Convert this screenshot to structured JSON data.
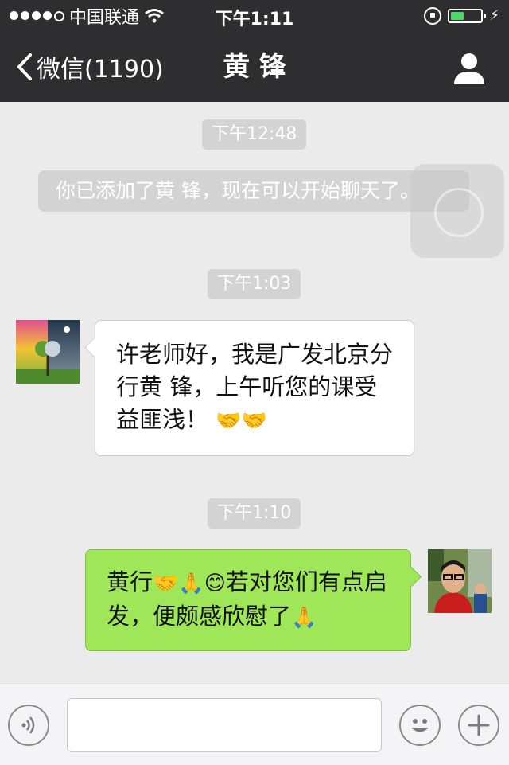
{
  "status_bar": {
    "carrier": "中国联通",
    "time": "下午1:11",
    "battery_level": 0.45
  },
  "nav": {
    "back_label": "微信(1190)",
    "title": "黄 锋"
  },
  "messages": {
    "t1": "下午12:48",
    "system": "你已添加了黄 锋，现在可以开始聊天了。",
    "t2": "下午1:03",
    "incoming_text": "许老师好，我是广发北京分行黄 锋，上午听您的课受益匪浅！",
    "incoming_emoji": "🤝🤝",
    "t3": "下午1:10",
    "outgoing_part1": "黄行",
    "outgoing_emoji1": "🤝🙏😊",
    "outgoing_part2": "若对您们有点启发，便颇感欣慰了",
    "outgoing_emoji2": "🙏"
  },
  "input_bar": {
    "input_value": ""
  },
  "icons": {
    "voice": "voice-icon",
    "emoji": "emoji-icon",
    "plus": "plus-icon",
    "back": "chevron-left-icon",
    "profile": "person-icon"
  },
  "colors": {
    "bar": "#2e2e30",
    "chat_bg": "#ebebeb",
    "outgoing": "#9fe659",
    "stamp": "#d3d3d3"
  }
}
